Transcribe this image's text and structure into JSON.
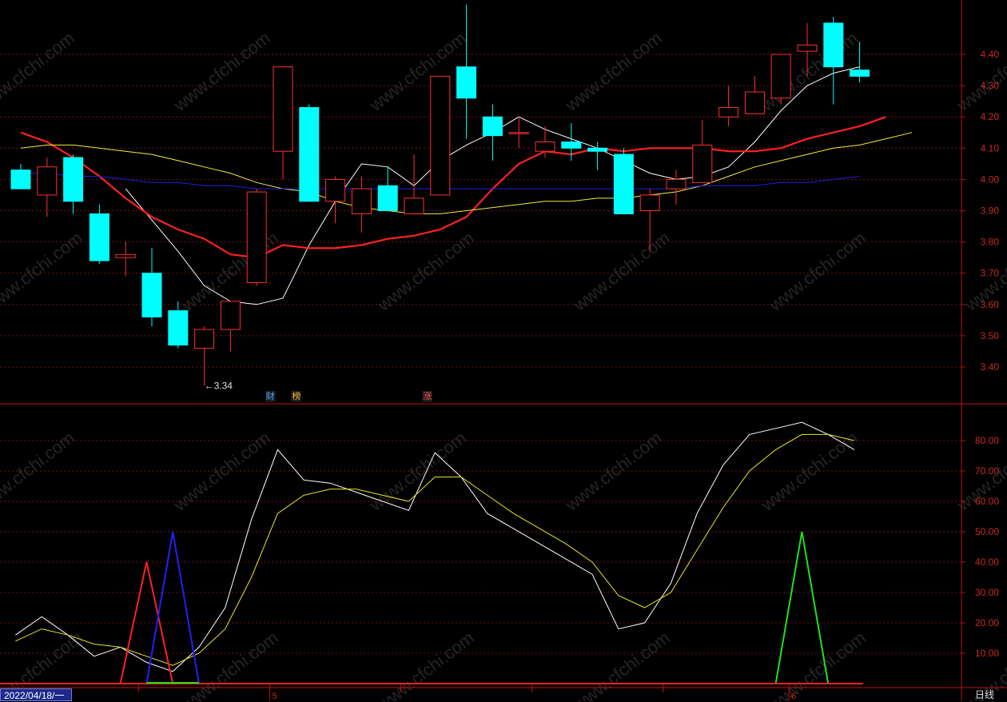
{
  "chart_data": [
    {
      "type": "candlestick",
      "title": "",
      "ylim": [
        3.3,
        4.5
      ],
      "y_ticks": [
        "3.40",
        "3.50",
        "3.60",
        "3.70",
        "3.80",
        "3.90",
        "4.00",
        "4.10",
        "4.20",
        "4.30",
        "4.40"
      ],
      "candles": [
        {
          "o": 4.03,
          "h": 4.05,
          "l": 3.98,
          "c": 3.97
        },
        {
          "o": 3.95,
          "h": 4.07,
          "l": 3.88,
          "c": 4.04
        },
        {
          "o": 4.07,
          "h": 4.08,
          "l": 3.89,
          "c": 3.93
        },
        {
          "o": 3.89,
          "h": 3.92,
          "l": 3.73,
          "c": 3.74
        },
        {
          "o": 3.75,
          "h": 3.8,
          "l": 3.69,
          "c": 3.76
        },
        {
          "o": 3.7,
          "h": 3.78,
          "l": 3.53,
          "c": 3.56
        },
        {
          "o": 3.58,
          "h": 3.61,
          "l": 3.46,
          "c": 3.47
        },
        {
          "o": 3.46,
          "h": 3.53,
          "l": 3.34,
          "c": 3.52
        },
        {
          "o": 3.52,
          "h": 3.61,
          "l": 3.45,
          "c": 3.61
        },
        {
          "o": 3.67,
          "h": 3.97,
          "l": 3.66,
          "c": 3.96
        },
        {
          "o": 4.09,
          "h": 4.36,
          "l": 4.0,
          "c": 4.36
        },
        {
          "o": 4.23,
          "h": 4.24,
          "l": 3.93,
          "c": 3.93
        },
        {
          "o": 3.93,
          "h": 4.01,
          "l": 3.86,
          "c": 4.0
        },
        {
          "o": 3.89,
          "h": 4.01,
          "l": 3.83,
          "c": 3.97
        },
        {
          "o": 3.98,
          "h": 4.04,
          "l": 3.9,
          "c": 3.9
        },
        {
          "o": 3.89,
          "h": 4.08,
          "l": 3.89,
          "c": 3.94
        },
        {
          "o": 3.95,
          "h": 4.33,
          "l": 3.95,
          "c": 4.33
        },
        {
          "o": 4.36,
          "h": 4.56,
          "l": 4.13,
          "c": 4.26
        },
        {
          "o": 4.2,
          "h": 4.24,
          "l": 4.06,
          "c": 4.14
        },
        {
          "o": 4.15,
          "h": 4.2,
          "l": 4.1,
          "c": 4.15
        },
        {
          "o": 4.09,
          "h": 4.17,
          "l": 4.07,
          "c": 4.12
        },
        {
          "o": 4.12,
          "h": 4.18,
          "l": 4.06,
          "c": 4.1
        },
        {
          "o": 4.1,
          "h": 4.12,
          "l": 4.03,
          "c": 4.09
        },
        {
          "o": 4.08,
          "h": 4.1,
          "l": 3.89,
          "c": 3.89
        },
        {
          "o": 3.9,
          "h": 3.97,
          "l": 3.77,
          "c": 3.95
        },
        {
          "o": 3.97,
          "h": 4.03,
          "l": 3.92,
          "c": 4.0
        },
        {
          "o": 3.99,
          "h": 4.19,
          "l": 3.99,
          "c": 4.11
        },
        {
          "o": 4.2,
          "h": 4.3,
          "l": 4.17,
          "c": 4.23
        },
        {
          "o": 4.21,
          "h": 4.33,
          "l": 4.21,
          "c": 4.28
        },
        {
          "o": 4.26,
          "h": 4.4,
          "l": 4.24,
          "c": 4.4
        },
        {
          "o": 4.41,
          "h": 4.5,
          "l": 4.33,
          "c": 4.43
        },
        {
          "o": 4.5,
          "h": 4.52,
          "l": 4.24,
          "c": 4.36
        },
        {
          "o": 4.35,
          "h": 4.44,
          "l": 4.31,
          "c": 4.33
        }
      ],
      "series": [
        {
          "color": "#ffffff",
          "values": [
            null,
            null,
            null,
            null,
            3.97,
            3.87,
            3.77,
            3.66,
            3.61,
            3.6,
            3.62,
            3.79,
            3.93,
            4.05,
            4.04,
            3.98,
            4.06,
            4.11,
            4.15,
            4.2,
            4.16,
            4.13,
            4.1,
            4.06,
            4.02,
            4.0,
            4.01,
            4.04,
            4.12,
            4.22,
            4.3,
            4.34,
            4.36
          ]
        },
        {
          "color": "#ff2020",
          "values": [
            4.15,
            4.12,
            4.07,
            4.01,
            3.94,
            3.88,
            3.84,
            3.81,
            3.76,
            3.75,
            3.79,
            3.78,
            3.78,
            3.79,
            3.81,
            3.82,
            3.84,
            3.88,
            3.97,
            4.05,
            4.09,
            4.08,
            4.1,
            4.09,
            4.1,
            4.1,
            4.1,
            4.09,
            4.09,
            4.1,
            4.13,
            4.15,
            4.17,
            4.2
          ]
        },
        {
          "color": "#eeee40",
          "values": [
            4.1,
            4.11,
            4.11,
            4.1,
            4.09,
            4.08,
            4.06,
            4.04,
            4.02,
            3.99,
            3.97,
            3.96,
            3.93,
            3.91,
            3.9,
            3.89,
            3.89,
            3.9,
            3.91,
            3.92,
            3.93,
            3.93,
            3.94,
            3.94,
            3.95,
            3.96,
            3.98,
            4.01,
            4.04,
            4.06,
            4.08,
            4.1,
            4.11,
            4.13,
            4.15
          ]
        },
        {
          "color": "#2020dd",
          "values": [
            4.02,
            4.02,
            4.01,
            4.01,
            4.0,
            3.99,
            3.99,
            3.98,
            3.98,
            3.97,
            3.97,
            3.97,
            3.97,
            3.97,
            3.97,
            3.97,
            3.97,
            3.97,
            3.97,
            3.97,
            3.97,
            3.97,
            3.97,
            3.97,
            3.97,
            3.97,
            3.98,
            3.98,
            3.98,
            3.99,
            3.99,
            4.0,
            4.01
          ]
        }
      ],
      "low_label": "3.34",
      "event_marks": [
        {
          "text": "财",
          "color": "#4fa3ff"
        },
        {
          "text": "榜",
          "color": "#ffb347"
        },
        {
          "text": "涨",
          "color": "#ff4f4f"
        }
      ]
    },
    {
      "type": "line",
      "ylim": [
        0,
        90
      ],
      "y_ticks": [
        "10.00",
        "20.00",
        "30.00",
        "40.00",
        "50.00",
        "60.00",
        "70.00",
        "80.00"
      ],
      "series": [
        {
          "color": "#ffffff",
          "values": [
            16,
            22,
            16,
            9,
            12,
            7,
            4,
            12,
            25,
            54,
            77,
            67,
            66,
            63,
            60,
            57,
            76,
            68,
            56,
            51,
            46,
            41,
            36,
            18,
            20,
            33,
            56,
            72,
            82,
            84,
            86,
            82,
            77
          ]
        },
        {
          "color": "#e6e62a",
          "values": [
            14,
            18,
            16,
            13,
            12,
            9,
            6,
            10,
            18,
            35,
            56,
            62,
            64,
            64,
            62,
            60,
            68,
            68,
            62,
            56,
            51,
            46,
            40,
            29,
            25,
            30,
            44,
            58,
            70,
            77,
            82,
            82,
            80
          ]
        }
      ],
      "peaks": [
        {
          "color": "#ff2020",
          "value": 40
        },
        {
          "color": "#2020ff",
          "value": 50
        },
        {
          "color": "#20e020",
          "value": 50
        }
      ]
    }
  ],
  "x_labels": [
    "5",
    "6"
  ],
  "footer": {
    "date": "2022/04/18/一",
    "period": "日线"
  },
  "watermark": "www.cfchi.com",
  "colors": {
    "up": "#ff3030",
    "down": "#00ffff",
    "grid": "#7a1010",
    "axis": "#c01010",
    "tick_text": "#c82828"
  }
}
